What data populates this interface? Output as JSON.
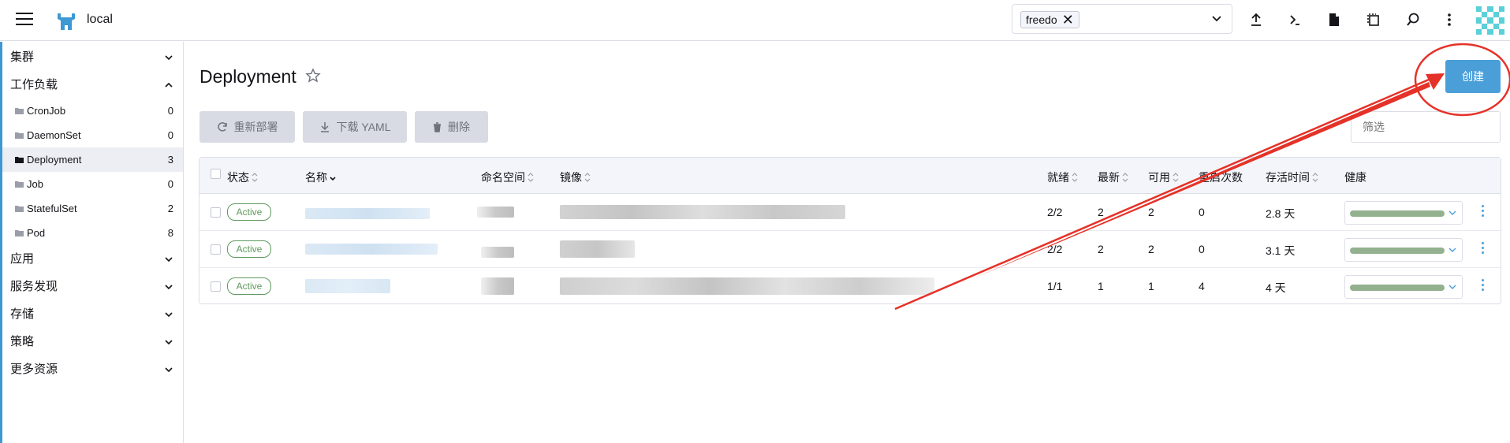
{
  "header": {
    "cluster_name": "local",
    "namespace_chip": "freedo",
    "remove_chip": "✕"
  },
  "sidebar": {
    "groups": [
      {
        "label": "集群"
      },
      {
        "label": "工作负载"
      },
      {
        "label": "应用"
      },
      {
        "label": "服务发现"
      },
      {
        "label": "存储"
      },
      {
        "label": "策略"
      },
      {
        "label": "更多资源"
      }
    ],
    "workload_items": [
      {
        "label": "CronJob",
        "count": "0"
      },
      {
        "label": "DaemonSet",
        "count": "0"
      },
      {
        "label": "Deployment",
        "count": "3"
      },
      {
        "label": "Job",
        "count": "0"
      },
      {
        "label": "StatefulSet",
        "count": "2"
      },
      {
        "label": "Pod",
        "count": "8"
      }
    ]
  },
  "main": {
    "title": "Deployment",
    "create_label": "创建",
    "bulk": {
      "redeploy": "重新部署",
      "download": "下载 YAML",
      "delete": "删除"
    },
    "filter_placeholder": "筛选",
    "columns": {
      "state": "状态",
      "name": "名称",
      "namespace": "命名空间",
      "image": "镜像",
      "ready": "就绪",
      "uptodate": "最新",
      "available": "可用",
      "restarts": "重启次数",
      "age": "存活时间",
      "health": "健康"
    },
    "rows": [
      {
        "state": "Active",
        "ready": "2/2",
        "uptodate": "2",
        "available": "2",
        "restarts": "0",
        "age": "2.8 天",
        "health": 1.0
      },
      {
        "state": "Active",
        "ready": "2/2",
        "uptodate": "2",
        "available": "2",
        "restarts": "0",
        "age": "3.1 天",
        "health": 1.0
      },
      {
        "state": "Active",
        "ready": "1/1",
        "uptodate": "1",
        "available": "1",
        "restarts": "4",
        "age": "4 天",
        "health": 1.0
      }
    ]
  },
  "colors": {
    "accent": "#4b9fd9",
    "active": "#5d995d",
    "annotation": "#e53228"
  }
}
